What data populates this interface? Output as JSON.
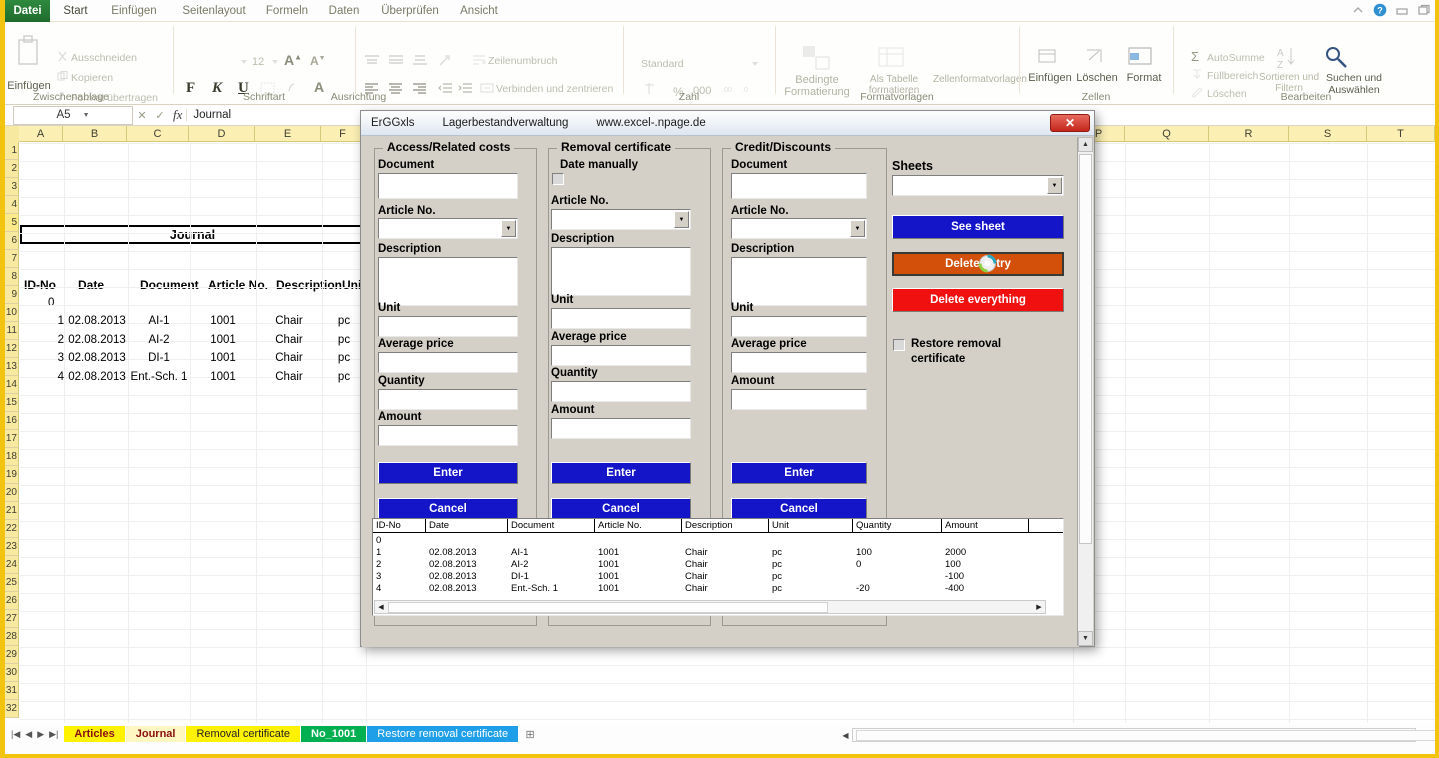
{
  "ribbon": {
    "file_tab": "Datei",
    "tabs": [
      {
        "label": "Start",
        "active": true
      },
      {
        "label": "Einfügen",
        "active": false
      },
      {
        "label": "Seitenlayout",
        "active": false
      },
      {
        "label": "Formeln",
        "active": false
      },
      {
        "label": "Daten",
        "active": false
      },
      {
        "label": "Überprüfen",
        "active": false
      },
      {
        "label": "Ansicht",
        "active": false
      }
    ],
    "groups": {
      "clipboard": {
        "label": "Zwischenablage",
        "paste": "Einfügen",
        "cut": "Ausschneiden",
        "copy": "Kopieren",
        "format_painter": "Format übertragen"
      },
      "font": {
        "label": "Schriftart",
        "size": "12",
        "bold": "F",
        "italic": "K",
        "underline": "U",
        "grow": "A",
        "shrink": "A"
      },
      "alignment": {
        "label": "Ausrichtung",
        "wrap_text": "Zeilenumbruch",
        "merge_center": "Verbinden und zentrieren"
      },
      "number": {
        "label": "Zahl",
        "format": "Standard",
        "percent": "%",
        "thousands": "000"
      },
      "styles": {
        "label": "Formatvorlagen",
        "conditional": "Bedingte Formatierung",
        "as_table": "Als Tabelle formatieren",
        "cell_styles": "Zellenformatvorlagen"
      },
      "cells": {
        "label": "Zellen",
        "insert": "Einfügen",
        "delete": "Löschen",
        "format": "Format"
      },
      "editing": {
        "label": "Bearbeiten",
        "autosum": "AutoSumme",
        "fill": "Füllbereich",
        "clear": "Löschen",
        "sort_filter": "Sortieren und Filtern",
        "find_select": "Suchen und Auswählen"
      }
    }
  },
  "formula_bar": {
    "name_box": "A5",
    "cancel": "✕",
    "accept": "✓",
    "fx": "fx",
    "content": "Journal"
  },
  "sheet": {
    "columns": [
      "A",
      "B",
      "C",
      "D",
      "E",
      "F",
      "P",
      "Q",
      "R",
      "S",
      "T"
    ],
    "rows": [
      "1",
      "2",
      "3",
      "4",
      "5",
      "6",
      "7",
      "8",
      "9",
      "10",
      "11",
      "12",
      "13",
      "14",
      "15",
      "16",
      "17",
      "18",
      "19",
      "20",
      "21",
      "22",
      "23",
      "24",
      "25",
      "26",
      "27",
      "28",
      "29",
      "30",
      "31",
      "32"
    ],
    "selected_row": "5",
    "journal_title": "Journal",
    "headers": [
      "ID-No",
      "Date",
      "Document",
      "Article No.",
      "Description",
      "Unit"
    ],
    "zero_row": "0",
    "rows_data": [
      {
        "id": "1",
        "date": "02.08.2013",
        "doc": "AI-1",
        "art": "1001",
        "desc": "Chair",
        "unit": "pc"
      },
      {
        "id": "2",
        "date": "02.08.2013",
        "doc": "AI-2",
        "art": "1001",
        "desc": "Chair",
        "unit": "pc"
      },
      {
        "id": "3",
        "date": "02.08.2013",
        "doc": "DI-1",
        "art": "1001",
        "desc": "Chair",
        "unit": "pc"
      },
      {
        "id": "4",
        "date": "02.08.2013",
        "doc": "Ent.-Sch. 1",
        "art": "1001",
        "desc": "Chair",
        "unit": "pc"
      }
    ]
  },
  "sheet_tabs": {
    "nav_first": "|◀",
    "nav_prev": "◀",
    "nav_next": "▶",
    "nav_last": "▶|",
    "items": [
      {
        "label": "Articles",
        "color": "#fff200",
        "active": false
      },
      {
        "label": "Journal",
        "color": "#fff200",
        "active": true
      },
      {
        "label": "Removal certificate",
        "color": "#fff200",
        "active": false
      },
      {
        "label": "No_1001",
        "color": "#00b050",
        "active": false
      },
      {
        "label": "Restore removal certificate",
        "color": "#1f9fe8",
        "active": false
      }
    ],
    "new_sheet": "⊞"
  },
  "dialog": {
    "title_app": "ErGGxls",
    "title_name": "Lagerbestandverwaltung",
    "title_url": "www.excel-.npage.de",
    "close": "✕",
    "panel_access": {
      "legend": "Access/Related costs",
      "fields": [
        {
          "label": "Document",
          "type": "text",
          "value": ""
        },
        {
          "label": "Article No.",
          "type": "combo",
          "value": ""
        },
        {
          "label": "Description",
          "type": "textarea",
          "value": ""
        },
        {
          "label": "Unit",
          "type": "text",
          "value": ""
        },
        {
          "label": "Average price",
          "type": "text",
          "value": ""
        },
        {
          "label": "Quantity",
          "type": "text",
          "value": ""
        },
        {
          "label": "Amount",
          "type": "text",
          "value": ""
        }
      ],
      "enter": "Enter",
      "cancel": "Cancel"
    },
    "panel_removal": {
      "legend": "Removal certificate",
      "date_manually_label": "Date manually",
      "date_manually_checked": false,
      "fields": [
        {
          "label": "Article No.",
          "type": "combo",
          "value": ""
        },
        {
          "label": "Description",
          "type": "textarea",
          "value": ""
        },
        {
          "label": "Unit",
          "type": "text",
          "value": ""
        },
        {
          "label": "Average price",
          "type": "text",
          "value": ""
        },
        {
          "label": "Quantity",
          "type": "text",
          "value": ""
        },
        {
          "label": "Amount",
          "type": "text",
          "value": ""
        }
      ],
      "enter": "Enter",
      "cancel": "Cancel"
    },
    "panel_credit": {
      "legend": "Credit/Discounts",
      "fields": [
        {
          "label": "Document",
          "type": "text",
          "value": ""
        },
        {
          "label": "Article No.",
          "type": "combo",
          "value": ""
        },
        {
          "label": "Description",
          "type": "textarea",
          "value": ""
        },
        {
          "label": "Unit",
          "type": "text",
          "value": ""
        },
        {
          "label": "Average price",
          "type": "text",
          "value": ""
        },
        {
          "label": "Amount",
          "type": "text",
          "value": ""
        }
      ],
      "enter": "Enter",
      "cancel": "Cancel"
    },
    "panel_sheets": {
      "label": "Sheets",
      "selected": "",
      "see_sheet": "See sheet",
      "delete_entry": "Delete entry",
      "delete_everything": "Delete everything",
      "restore_label": "Restore removal certificate",
      "restore_checked": false
    },
    "datagrid": {
      "headers": [
        "ID-No",
        "Date",
        "Document",
        "Article No.",
        "Description",
        "Unit",
        "Quantity",
        "Amount"
      ],
      "zero_row": "0",
      "rows": [
        {
          "id": "1",
          "date": "02.08.2013",
          "doc": "AI-1",
          "art": "1001",
          "desc": "Chair",
          "unit": "pc",
          "qty": "100",
          "amt": "2000"
        },
        {
          "id": "2",
          "date": "02.08.2013",
          "doc": "AI-2",
          "art": "1001",
          "desc": "Chair",
          "unit": "pc",
          "qty": "0",
          "amt": "100"
        },
        {
          "id": "3",
          "date": "02.08.2013",
          "doc": "DI-1",
          "art": "1001",
          "desc": "Chair",
          "unit": "pc",
          "qty": "",
          "amt": "-100"
        },
        {
          "id": "4",
          "date": "02.08.2013",
          "doc": "Ent.-Sch. 1",
          "art": "1001",
          "desc": "Chair",
          "unit": "pc",
          "qty": "-20",
          "amt": "-400"
        }
      ]
    }
  },
  "colors": {
    "accent_yellow": "#f2c40f",
    "button_blue": "#1414c8",
    "button_orange": "#d2500a",
    "button_red": "#f01010",
    "file_tab_green": "#2f8a3f"
  }
}
